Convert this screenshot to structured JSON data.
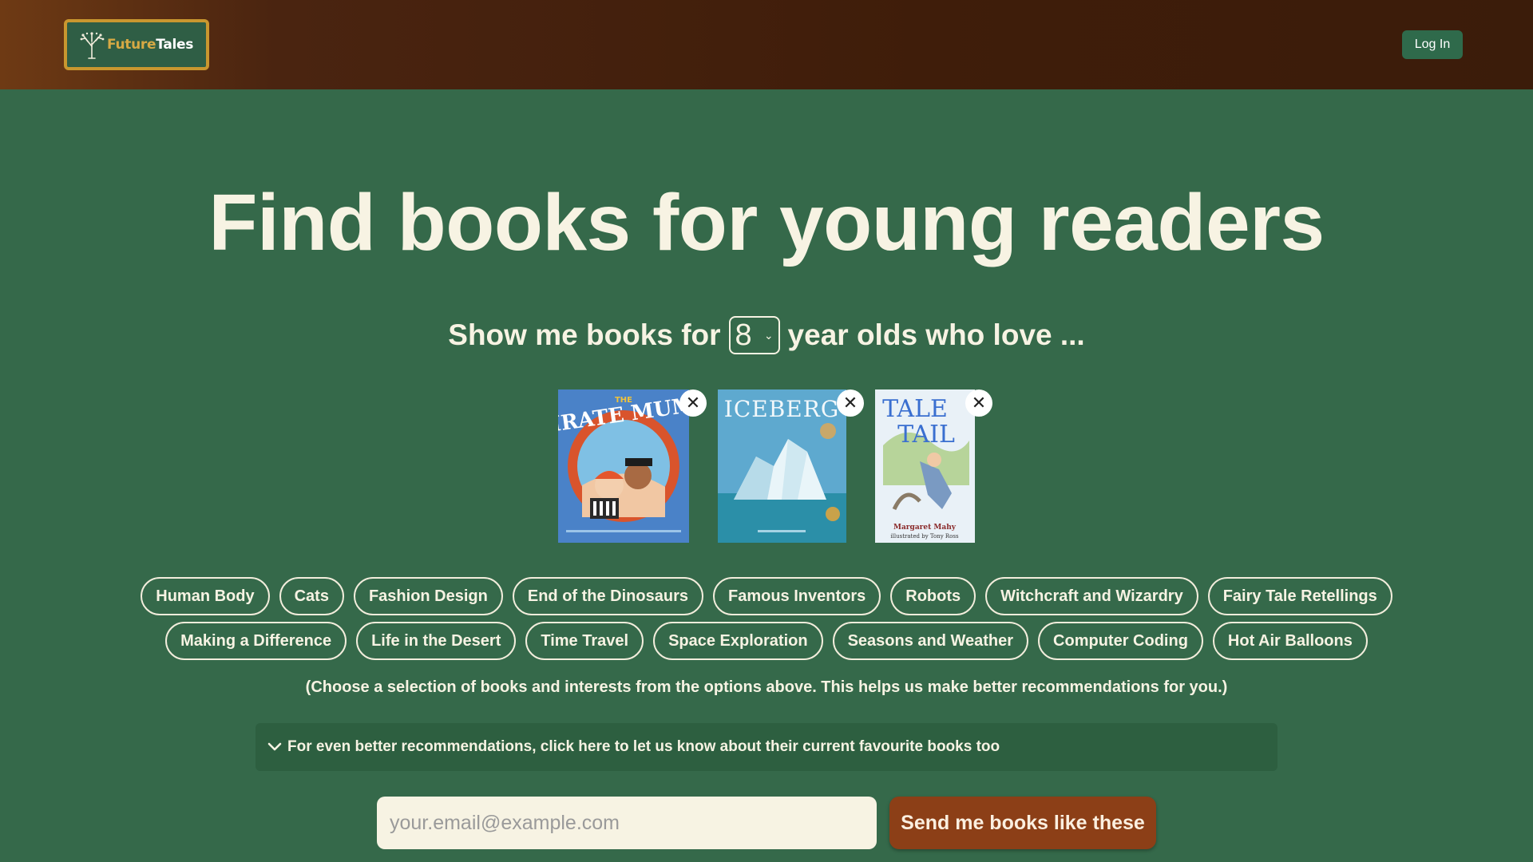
{
  "header": {
    "logo_part1": "Future",
    "logo_part2": "Tales",
    "login_label": "Log In"
  },
  "hero": {
    "title": "Find books for young readers"
  },
  "filter": {
    "prefix": "Show me books for",
    "age_value": "8",
    "suffix": "year olds who love ..."
  },
  "selected_books": [
    {
      "cover_title": "THE PIRATE MUMS",
      "cover_color": "#4a82c8"
    },
    {
      "cover_title": "ICEBERG",
      "cover_color": "#5ea9cf"
    },
    {
      "cover_title": "TALE of a TAIL",
      "cover_author": "Margaret Mahy",
      "cover_illustrator": "illustrated by Tony Ross",
      "cover_color": "#e9f1f7"
    }
  ],
  "interests_row1": [
    "Human Body",
    "Cats",
    "Fashion Design",
    "End of the Dinosaurs",
    "Famous Inventors",
    "Robots",
    "Witchcraft and Wizardry",
    "Fairy Tale Retellings"
  ],
  "interests_row2": [
    "Making a Difference",
    "Life in the Desert",
    "Time Travel",
    "Space Exploration",
    "Seasons and Weather",
    "Computer Coding",
    "Hot Air Balloons"
  ],
  "note": "(Choose a selection of books and interests from the options above. This helps us make better recommendations for you.)",
  "expander": {
    "label": "For even better recommendations, click here to let us know about their current favourite books too"
  },
  "signup": {
    "email_placeholder": "your.email@example.com",
    "submit_label": "Send me books like these"
  },
  "colors": {
    "background": "#35694a",
    "header": "#3f1d0a",
    "accent_gold": "#c9972f",
    "button_brown": "#8c3f17",
    "text_cream": "#f7f3e3"
  }
}
